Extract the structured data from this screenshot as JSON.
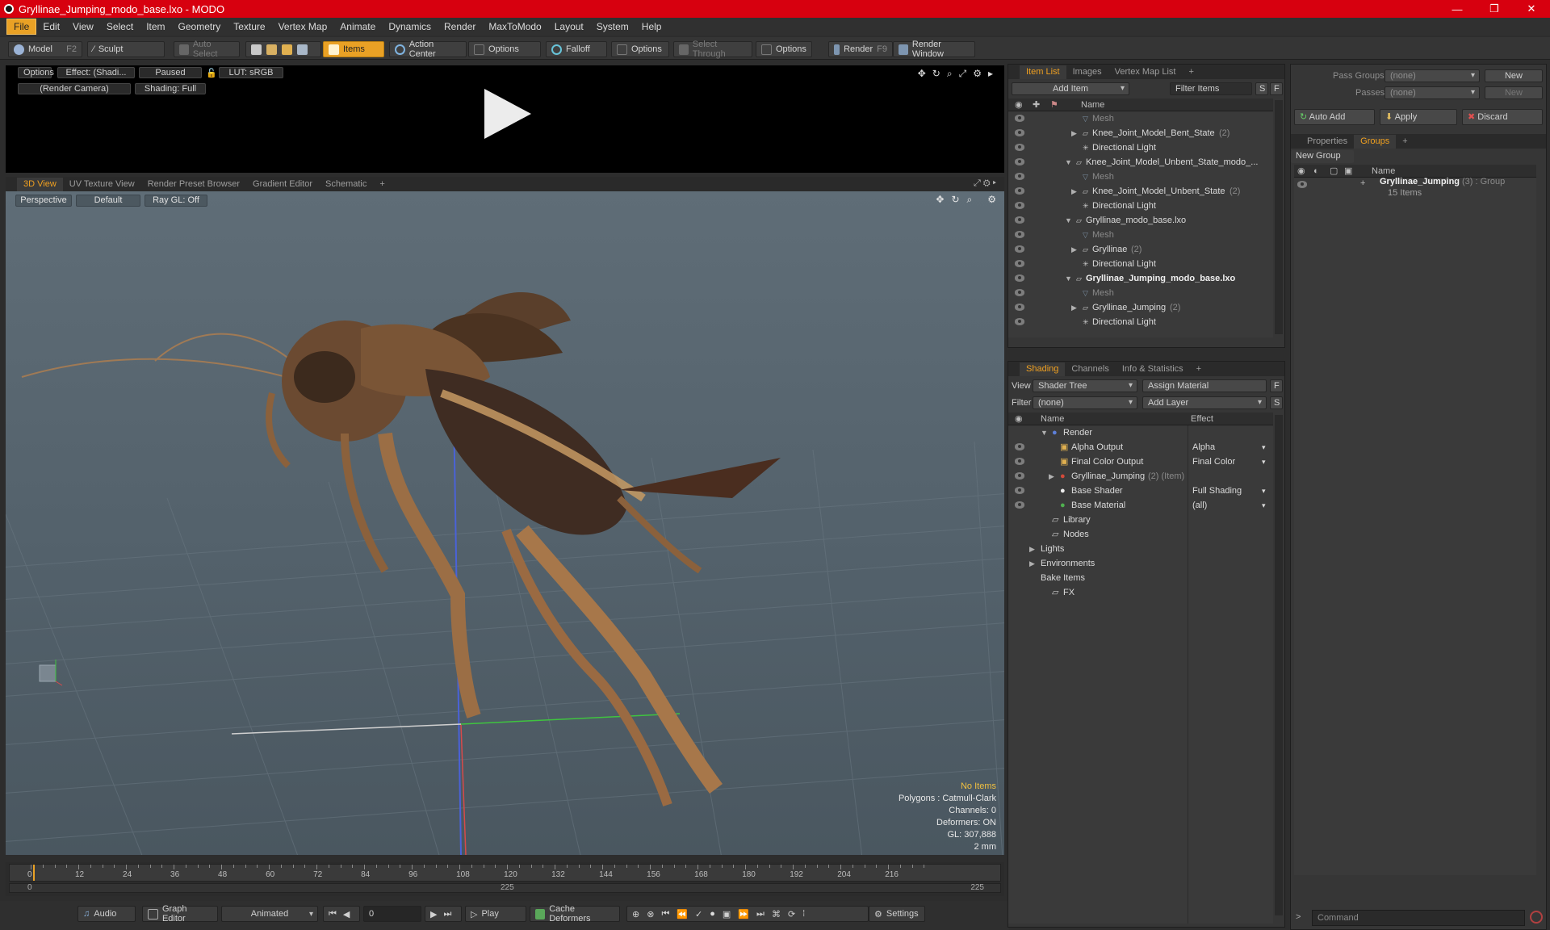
{
  "window": {
    "title": "Gryllinae_Jumping_modo_base.lxo - MODO",
    "min": "—",
    "max": "❐",
    "close": "✕"
  },
  "menu": [
    "File",
    "Edit",
    "View",
    "Select",
    "Item",
    "Geometry",
    "Texture",
    "Vertex Map",
    "Animate",
    "Dynamics",
    "Render",
    "MaxToModo",
    "Layout",
    "System",
    "Help"
  ],
  "toolbar": {
    "model": "Model",
    "model_key": "F2",
    "sculpt": "Sculpt",
    "auto_select": "Auto Select",
    "items": "Items",
    "action_center": "Action Center",
    "options1": "Options",
    "falloff": "Falloff",
    "options2": "Options",
    "select_through": "Select Through",
    "options3": "Options",
    "render": "Render",
    "render_key": "F9",
    "render_window": "Render Window"
  },
  "preview": {
    "options": "Options",
    "effect": "Effect: (Shadi...",
    "paused": "Paused",
    "lut": "LUT: sRGB",
    "camera": "(Render Camera)",
    "shading": "Shading: Full"
  },
  "view_tabs": [
    "3D View",
    "UV Texture View",
    "Render Preset Browser",
    "Gradient Editor",
    "Schematic",
    "+"
  ],
  "viewport": {
    "perspective": "Perspective",
    "default": "Default",
    "raygl": "Ray GL: Off",
    "stats": {
      "no_items": "No Items",
      "polygons": "Polygons : Catmull-Clark",
      "channels": "Channels: 0",
      "deformers": "Deformers: ON",
      "gl": "GL: 307,888",
      "unit": "2 mm"
    }
  },
  "timeline": {
    "ticks": [
      "0",
      "12",
      "24",
      "36",
      "48",
      "60",
      "72",
      "84",
      "96",
      "108",
      "120",
      "132",
      "144",
      "156",
      "168",
      "180",
      "192",
      "204",
      "216"
    ],
    "start": "0",
    "mid": "225",
    "end": "225"
  },
  "bottom": {
    "audio": "Audio",
    "graph_editor": "Graph Editor",
    "animated": "Animated",
    "frame": "0",
    "play": "Play",
    "cache": "Cache Deformers",
    "settings": "Settings"
  },
  "item_list": {
    "tabs": [
      "Item List",
      "Images",
      "Vertex Map List",
      "+"
    ],
    "add_item": "Add Item",
    "filter": "Filter Items",
    "s": "S",
    "f": "F",
    "col_name": "Name",
    "rows": [
      {
        "label": "Mesh",
        "count": "",
        "muted": true,
        "bold": false,
        "indent": 2,
        "arrow": ""
      },
      {
        "label": "Knee_Joint_Model_Bent_State",
        "count": "(2)",
        "muted": false,
        "bold": false,
        "indent": 2,
        "arrow": "▶"
      },
      {
        "label": "Directional Light",
        "count": "",
        "muted": false,
        "bold": false,
        "indent": 2,
        "arrow": ""
      },
      {
        "label": "Knee_Joint_Model_Unbent_State_modo_...",
        "count": "",
        "muted": false,
        "bold": false,
        "indent": 1,
        "arrow": "▼"
      },
      {
        "label": "Mesh",
        "count": "",
        "muted": true,
        "bold": false,
        "indent": 2,
        "arrow": ""
      },
      {
        "label": "Knee_Joint_Model_Unbent_State",
        "count": "(2)",
        "muted": false,
        "bold": false,
        "indent": 2,
        "arrow": "▶"
      },
      {
        "label": "Directional Light",
        "count": "",
        "muted": false,
        "bold": false,
        "indent": 2,
        "arrow": ""
      },
      {
        "label": "Gryllinae_modo_base.lxo",
        "count": "",
        "muted": false,
        "bold": false,
        "indent": 1,
        "arrow": "▼"
      },
      {
        "label": "Mesh",
        "count": "",
        "muted": true,
        "bold": false,
        "indent": 2,
        "arrow": ""
      },
      {
        "label": "Gryllinae",
        "count": "(2)",
        "muted": false,
        "bold": false,
        "indent": 2,
        "arrow": "▶"
      },
      {
        "label": "Directional Light",
        "count": "",
        "muted": false,
        "bold": false,
        "indent": 2,
        "arrow": ""
      },
      {
        "label": "Gryllinae_Jumping_modo_base.lxo",
        "count": "",
        "muted": false,
        "bold": true,
        "indent": 1,
        "arrow": "▼"
      },
      {
        "label": "Mesh",
        "count": "",
        "muted": true,
        "bold": false,
        "indent": 2,
        "arrow": ""
      },
      {
        "label": "Gryllinae_Jumping",
        "count": "(2)",
        "muted": false,
        "bold": false,
        "indent": 2,
        "arrow": "▶"
      },
      {
        "label": "Directional Light",
        "count": "",
        "muted": false,
        "bold": false,
        "indent": 2,
        "arrow": ""
      }
    ]
  },
  "shading": {
    "tabs": [
      "Shading",
      "Channels",
      "Info & Statistics",
      "+"
    ],
    "view_label": "View",
    "view_value": "Shader Tree",
    "assign": "Assign Material",
    "filter_label": "Filter",
    "filter_value": "(none)",
    "add_layer": "Add Layer",
    "f": "F",
    "s": "S",
    "col_name": "Name",
    "col_effect": "Effect",
    "rows": [
      {
        "label": "Render",
        "extra": "",
        "effect": "",
        "indent": 0,
        "arrow": "▼",
        "eye": false
      },
      {
        "label": "Alpha Output",
        "extra": "",
        "effect": "Alpha",
        "indent": 1,
        "arrow": "",
        "eye": true
      },
      {
        "label": "Final Color Output",
        "extra": "",
        "effect": "Final Color",
        "indent": 1,
        "arrow": "",
        "eye": true
      },
      {
        "label": "Gryllinae_Jumping",
        "extra": "(2) (Item)",
        "effect": "",
        "indent": 1,
        "arrow": "▶",
        "eye": true
      },
      {
        "label": "Base Shader",
        "extra": "",
        "effect": "Full Shading",
        "indent": 1,
        "arrow": "",
        "eye": true
      },
      {
        "label": "Base Material",
        "extra": "",
        "effect": "(all)",
        "indent": 1,
        "arrow": "",
        "eye": true
      },
      {
        "label": "Library",
        "extra": "",
        "effect": "",
        "indent": 0,
        "arrow": "",
        "eye": false
      },
      {
        "label": "Nodes",
        "extra": "",
        "effect": "",
        "indent": 0,
        "arrow": "",
        "eye": false
      },
      {
        "label": "Lights",
        "extra": "",
        "effect": "",
        "indent": -1,
        "arrow": "▶",
        "eye": false
      },
      {
        "label": "Environments",
        "extra": "",
        "effect": "",
        "indent": -1,
        "arrow": "▶",
        "eye": false
      },
      {
        "label": "Bake Items",
        "extra": "",
        "effect": "",
        "indent": -1,
        "arrow": "",
        "eye": false
      },
      {
        "label": "FX",
        "extra": "",
        "effect": "",
        "indent": 0,
        "arrow": "",
        "eye": false
      }
    ]
  },
  "right": {
    "pass_groups": "Pass Groups",
    "passes": "Passes",
    "none1": "(none)",
    "none2": "(none)",
    "new1": "New",
    "new2": "New",
    "auto_add": "Auto Add",
    "apply": "Apply",
    "discard": "Discard",
    "tabs": [
      "Properties",
      "Groups",
      "+"
    ],
    "new_group": "New Group",
    "col_name": "Name",
    "group_name": "Gryllinae_Jumping",
    "group_count": "(3) : Group",
    "group_items": "15 Items"
  },
  "command": {
    "placeholder": "Command",
    "prompt": ">"
  }
}
